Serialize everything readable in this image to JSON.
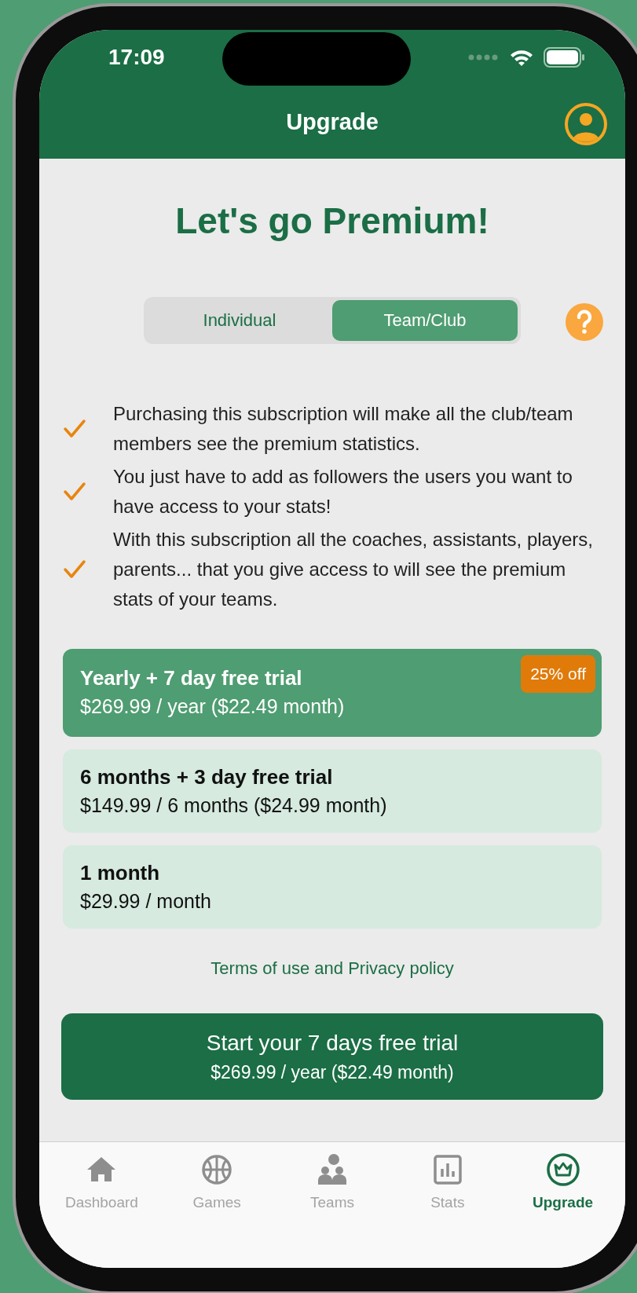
{
  "status_bar": {
    "time": "17:09"
  },
  "header": {
    "title": "Upgrade"
  },
  "headline": "Let's go Premium!",
  "segments": [
    {
      "label": "Individual",
      "selected": false
    },
    {
      "label": "Team/Club",
      "selected": true
    }
  ],
  "features": [
    "Purchasing this subscription will make all the club/team members see the premium statistics.",
    "You just have to add as followers the users you want to have access to your stats!",
    "With this subscription all the coaches, assistants, players, parents... that you give access to will see the premium stats of your teams."
  ],
  "plans": [
    {
      "title": "Yearly + 7 day free trial",
      "price": "$269.99 / year ($22.49 month)",
      "badge": "25% off",
      "selected": true
    },
    {
      "title": "6 months + 3 day free trial",
      "price": "$149.99 / 6 months ($24.99 month)",
      "selected": false
    },
    {
      "title": "1 month",
      "price": "$29.99 / month",
      "selected": false
    }
  ],
  "terms_link": "Terms of use and Privacy policy",
  "cta": {
    "title": "Start your 7 days free trial",
    "subtitle": "$269.99 / year ($22.49 month)"
  },
  "tab_bar": [
    {
      "kind": "home",
      "label": "Dashboard",
      "selected": false
    },
    {
      "kind": "ball",
      "label": "Games",
      "selected": false
    },
    {
      "kind": "team",
      "label": "Teams",
      "selected": false
    },
    {
      "kind": "stats",
      "label": "Stats",
      "selected": false
    },
    {
      "kind": "crown",
      "label": "Upgrade",
      "selected": true
    }
  ]
}
